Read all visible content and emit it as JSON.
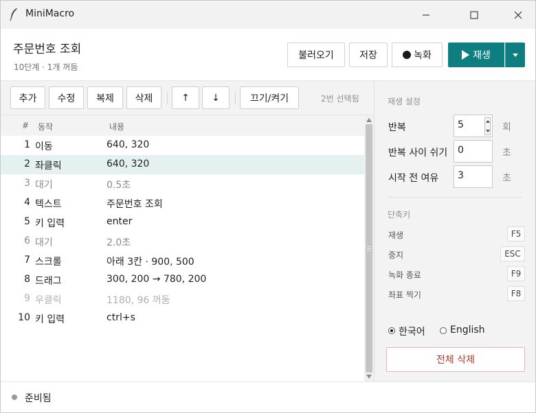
{
  "window": {
    "title": "MiniMacro",
    "icon": "feather-icon"
  },
  "header": {
    "title": "주문번호 조회",
    "subtitle": "10단계 · 1개 꺼둠",
    "load_label": "불러오기",
    "save_label": "저장",
    "record_label": "녹화",
    "play_label": "재생",
    "accent_color": "#0f7e80"
  },
  "toolbar": {
    "add": "추가",
    "edit": "수정",
    "duplicate": "복제",
    "delete": "삭제",
    "up": "↑",
    "down": "↓",
    "toggle": "끄기/켜기",
    "selection": "2번 선택됨"
  },
  "list": {
    "headers": {
      "num": "#",
      "action": "동작",
      "content": "내용"
    },
    "rows": [
      {
        "num": "1",
        "action": "이동",
        "content": "640, 320",
        "state": "normal"
      },
      {
        "num": "2",
        "action": "좌클릭",
        "content": "640, 320",
        "state": "selected"
      },
      {
        "num": "3",
        "action": "대기",
        "content": "0.5초",
        "state": "wait"
      },
      {
        "num": "4",
        "action": "텍스트",
        "content": "주문번호 조회",
        "state": "normal"
      },
      {
        "num": "5",
        "action": "키 입력",
        "content": "enter",
        "state": "normal"
      },
      {
        "num": "6",
        "action": "대기",
        "content": "2.0초",
        "state": "wait"
      },
      {
        "num": "7",
        "action": "스크롤",
        "content": "아래 3칸 · 900, 500",
        "state": "normal"
      },
      {
        "num": "8",
        "action": "드래그",
        "content": "300, 200 → 780, 200",
        "state": "normal"
      },
      {
        "num": "9",
        "action": "우클릭",
        "content": "1180, 96  꺼둠",
        "state": "off"
      },
      {
        "num": "10",
        "action": "키 입력",
        "content": "ctrl+s",
        "state": "normal"
      }
    ]
  },
  "panel": {
    "playback_title": "재생 설정",
    "repeat_label": "반복",
    "repeat_value": "5",
    "repeat_unit": "회",
    "gap_label": "반복 사이 쉬기",
    "gap_value": "0",
    "gap_unit": "초",
    "delay_label": "시작 전 여유",
    "delay_value": "3",
    "delay_unit": "초",
    "shortcut_title": "단축키",
    "shortcuts": [
      {
        "label": "재생",
        "key": "F5"
      },
      {
        "label": "중지",
        "key": "ESC"
      },
      {
        "label": "녹화 종료",
        "key": "F9"
      },
      {
        "label": "좌표 찍기",
        "key": "F8"
      }
    ],
    "lang_korean": "한국어",
    "lang_english": "English",
    "selected_language": "한국어",
    "clear_all": "전체 삭제"
  },
  "status": {
    "text": "준비됨"
  }
}
